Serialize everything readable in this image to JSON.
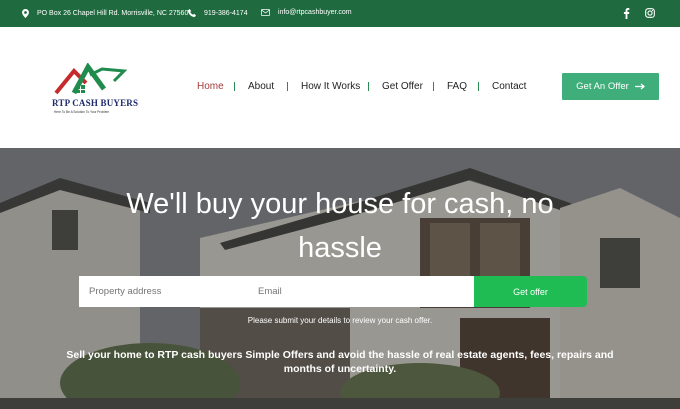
{
  "topbar": {
    "address": "PO Box 26 Chapel Hill Rd. Morrisville, NC 27560",
    "phone": "919-386-4174",
    "email": "info@rtpcashbuyer.com",
    "icons": [
      "location-pin-icon",
      "phone-icon",
      "envelope-icon",
      "facebook-icon",
      "instagram-icon"
    ]
  },
  "logo": {
    "brand": "RTP CASH BUYERS",
    "tagline": "Here To Be A Solution To Your Problem"
  },
  "nav": {
    "items": [
      "Home",
      "About",
      "How It Works",
      "Get Offer",
      "FAQ",
      "Contact"
    ],
    "active": "Home"
  },
  "cta": {
    "label": "Get An Offer"
  },
  "hero": {
    "headline": "We'll buy your house for cash, no hassle",
    "address_placeholder": "Property address",
    "email_placeholder": "Email",
    "submit_label": "Get offer",
    "note": "Please submit your details to review your cash offer.",
    "pitch": "Sell your home to RTP cash buyers Simple Offers and avoid the hassle of real estate agents, fees, repairs and months of uncertainty."
  },
  "colors": {
    "topbar": "#1f6b3f",
    "accent": "#3fae7a",
    "submit": "#1fbc54",
    "active_nav": "#a33a3a"
  }
}
